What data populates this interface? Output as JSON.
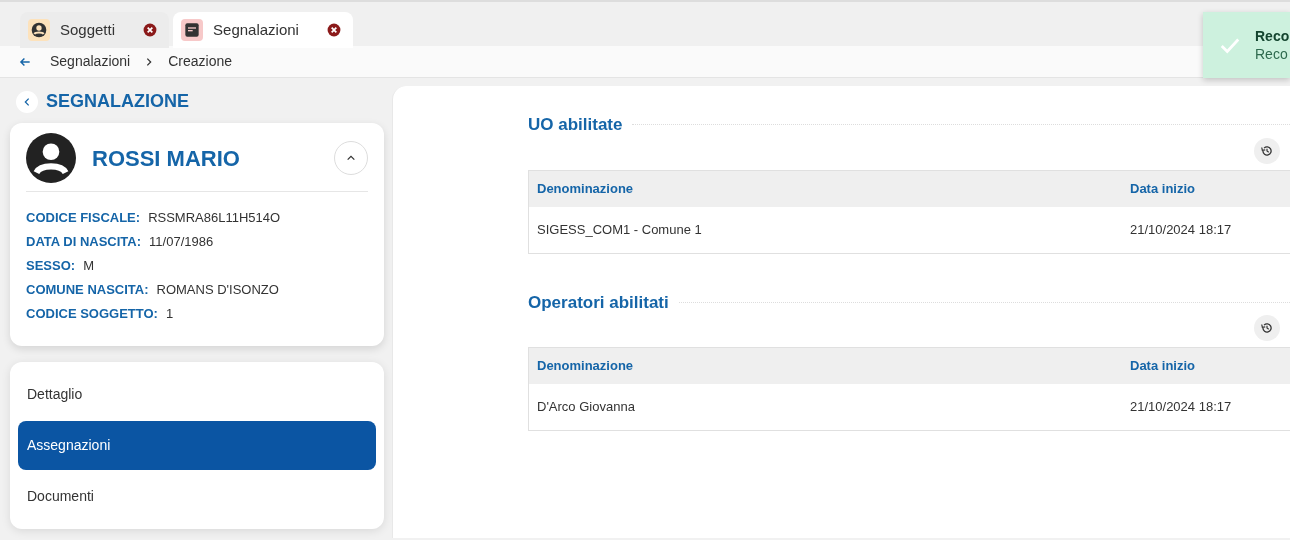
{
  "tabs": [
    {
      "label": "Soggetti",
      "kind": "person",
      "selected": false
    },
    {
      "label": "Segnalazioni",
      "kind": "note",
      "selected": true
    }
  ],
  "breadcrumb": [
    "Segnalazioni",
    "Creazione"
  ],
  "toast": {
    "title": "Reco",
    "message": "Reco"
  },
  "sidebar": {
    "title": "SEGNALAZIONE",
    "subject": {
      "name": "ROSSI MARIO",
      "expanded": true,
      "fields": [
        {
          "label": "CODICE FISCALE:",
          "value": "RSSMRA86L11H514O"
        },
        {
          "label": "DATA DI NASCITA:",
          "value": "11/07/1986"
        },
        {
          "label": "SESSO:",
          "value": "M"
        },
        {
          "label": "COMUNE NASCITA:",
          "value": "ROMANS D'ISONZO"
        },
        {
          "label": "CODICE SOGGETTO:",
          "value": "1"
        }
      ]
    },
    "menu": [
      {
        "label": "Dettaglio",
        "selected": false
      },
      {
        "label": "Assegnazioni",
        "selected": true
      },
      {
        "label": "Documenti",
        "selected": false
      }
    ]
  },
  "sections": [
    {
      "title": "UO abilitate",
      "table": {
        "columns": [
          "Denominazione",
          "Data inizio"
        ],
        "rows": [
          [
            "SIGESS_COM1 - Comune 1",
            "21/10/2024 18:17"
          ]
        ]
      }
    },
    {
      "title": "Operatori abilitati",
      "table": {
        "columns": [
          "Denominazione",
          "Data inizio"
        ],
        "rows": [
          [
            "D'Arco Giovanna",
            "21/10/2024 18:17"
          ]
        ]
      }
    }
  ]
}
